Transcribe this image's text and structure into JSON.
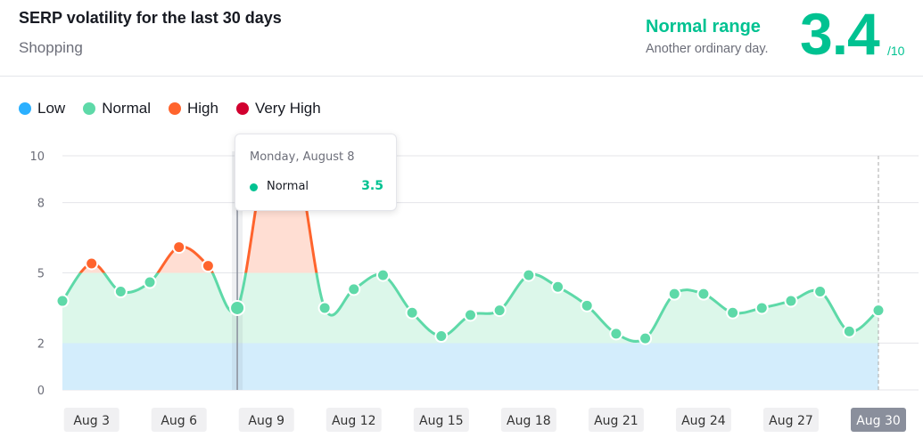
{
  "header": {
    "title": "SERP volatility for the last 30 days",
    "subtitle": "Shopping",
    "range_title": "Normal range",
    "range_desc": "Another ordinary day.",
    "score": "3.4",
    "score_max": "/10"
  },
  "legend": [
    {
      "label": "Low",
      "color": "#2bb0ff"
    },
    {
      "label": "Normal",
      "color": "#5ed9a8"
    },
    {
      "label": "High",
      "color": "#ff642d"
    },
    {
      "label": "Very High",
      "color": "#d1002f"
    }
  ],
  "tooltip": {
    "date": "Monday, August 8",
    "category": "Normal",
    "value": "3.5"
  },
  "chart_data": {
    "type": "area",
    "title": "",
    "ylim": [
      0,
      10
    ],
    "yticks": [
      "0",
      "2",
      "5",
      "8",
      "10"
    ],
    "thresholds": {
      "low_max": 2,
      "normal_max": 5,
      "high_max": 8
    },
    "xlabels": [
      "Aug 3",
      "Aug 6",
      "Aug 9",
      "Aug 12",
      "Aug 15",
      "Aug 18",
      "Aug 21",
      "Aug 24",
      "Aug 27",
      "Aug 30"
    ],
    "x": [
      "Aug 2",
      "Aug 3",
      "Aug 4",
      "Aug 5",
      "Aug 6",
      "Aug 7",
      "Aug 8",
      "Aug 9",
      "Aug 10",
      "Aug 11",
      "Aug 12",
      "Aug 13",
      "Aug 14",
      "Aug 15",
      "Aug 16",
      "Aug 17",
      "Aug 18",
      "Aug 19",
      "Aug 20",
      "Aug 21",
      "Aug 22",
      "Aug 23",
      "Aug 24",
      "Aug 25",
      "Aug 26",
      "Aug 27",
      "Aug 28",
      "Aug 29",
      "Aug 30"
    ],
    "values": [
      3.8,
      5.4,
      4.2,
      4.6,
      6.1,
      5.3,
      3.5,
      10,
      10,
      3.5,
      4.3,
      4.9,
      3.3,
      2.3,
      3.2,
      3.4,
      4.9,
      4.4,
      3.6,
      2.4,
      2.2,
      4.1,
      4.1,
      3.3,
      3.5,
      3.8,
      4.2,
      2.5,
      3.4
    ],
    "highlighted": "Aug 8",
    "selected_label": "Aug 30",
    "grid": true
  }
}
